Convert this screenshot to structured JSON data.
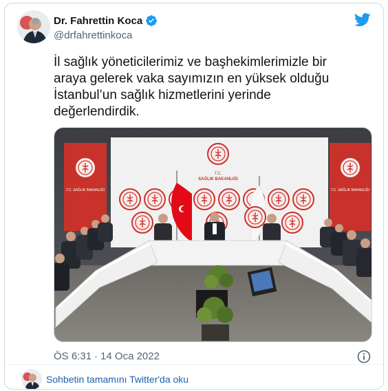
{
  "author": {
    "display_name": "Dr. Fahrettin Koca",
    "handle": "@drfahrettinkoca",
    "verified": true
  },
  "tweet": {
    "text": "İl sağlık yöneticilerimiz ve başhekimlerimizle bir\naraya gelerek vaka sayımızın en yüksek olduğu\nİstanbul’un sağlık hizmetlerini yerinde\ndeğerlendirdik.",
    "time": "ÖS 6:31",
    "separator": "·",
    "date": "14 Oca 2022"
  },
  "photo": {
    "banner_left": "T.C. SAĞLIK BAKANLIĞI",
    "banner_right": "T.C. SAĞLIK BAKANLIĞI",
    "backdrop_line1": "T.C.",
    "backdrop_line2": "SAĞLIK BAKANLIĞI"
  },
  "footer": {
    "link_text": "Sohbetin tamamını Twitter'da oku"
  },
  "icons": {
    "brand": "twitter-bird-icon",
    "verified": "verified-badge-icon",
    "info": "info-icon"
  },
  "colors": {
    "twitter_blue": "#1d9bf0",
    "link_blue": "#1d5ea8",
    "flag_red": "#e30a17",
    "banner_red": "#c8322a"
  }
}
